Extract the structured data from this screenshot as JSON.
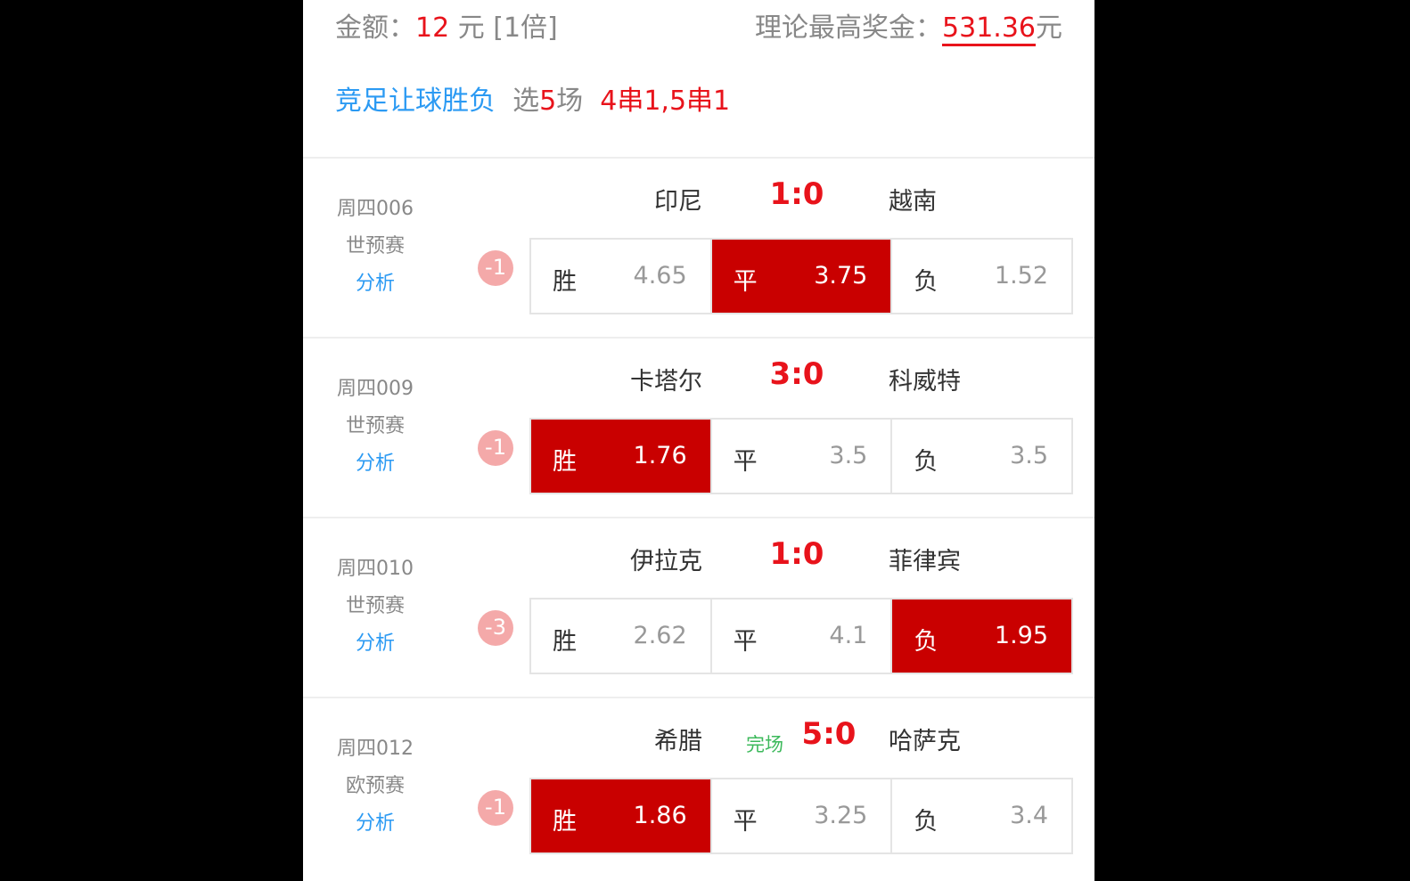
{
  "summary": {
    "amount_label": "金额：",
    "amount": "12",
    "amount_unit": "元 [1倍]",
    "prize_label": "理论最高奖金：",
    "prize": "531.36",
    "prize_unit": "元"
  },
  "bet": {
    "type": "竞足让球胜负",
    "pick_prefix": "选",
    "pick_count": "5",
    "pick_suffix": "场",
    "combos": "4串1,5串1"
  },
  "colors": {
    "selected": "#c90000",
    "accent_red": "#e8131b",
    "link_blue": "#2b9af3",
    "finished_green": "#3cb95b"
  },
  "matches": [
    {
      "id": "周四006",
      "league": "世预赛",
      "analysis": "分析",
      "home": "印尼",
      "score": "1:0",
      "status": "",
      "away": "越南",
      "handicap": "-1",
      "odds": [
        {
          "label": "胜",
          "value": "4.65",
          "selected": false
        },
        {
          "label": "平",
          "value": "3.75",
          "selected": true
        },
        {
          "label": "负",
          "value": "1.52",
          "selected": false
        }
      ]
    },
    {
      "id": "周四009",
      "league": "世预赛",
      "analysis": "分析",
      "home": "卡塔尔",
      "score": "3:0",
      "status": "",
      "away": "科威特",
      "handicap": "-1",
      "odds": [
        {
          "label": "胜",
          "value": "1.76",
          "selected": true
        },
        {
          "label": "平",
          "value": "3.5",
          "selected": false
        },
        {
          "label": "负",
          "value": "3.5",
          "selected": false
        }
      ]
    },
    {
      "id": "周四010",
      "league": "世预赛",
      "analysis": "分析",
      "home": "伊拉克",
      "score": "1:0",
      "status": "",
      "away": "菲律宾",
      "handicap": "-3",
      "odds": [
        {
          "label": "胜",
          "value": "2.62",
          "selected": false
        },
        {
          "label": "平",
          "value": "4.1",
          "selected": false
        },
        {
          "label": "负",
          "value": "1.95",
          "selected": true
        }
      ]
    },
    {
      "id": "周四012",
      "league": "欧预赛",
      "analysis": "分析",
      "home": "希腊",
      "score": "5:0",
      "status": "完场",
      "away": "哈萨克",
      "handicap": "-1",
      "odds": [
        {
          "label": "胜",
          "value": "1.86",
          "selected": true
        },
        {
          "label": "平",
          "value": "3.25",
          "selected": false
        },
        {
          "label": "负",
          "value": "3.4",
          "selected": false
        }
      ]
    }
  ]
}
